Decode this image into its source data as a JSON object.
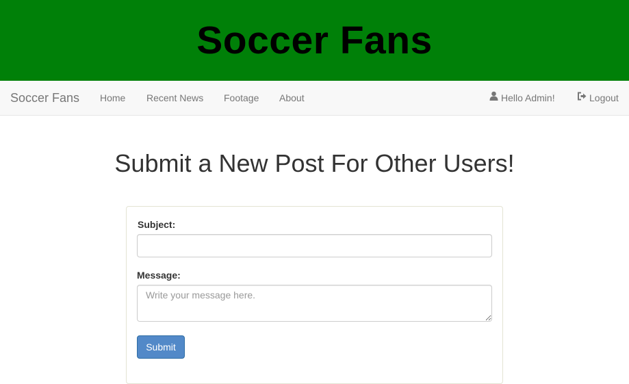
{
  "banner": {
    "title": "Soccer Fans"
  },
  "navbar": {
    "brand": "Soccer Fans",
    "links": [
      {
        "label": "Home"
      },
      {
        "label": "Recent News"
      },
      {
        "label": "Footage"
      },
      {
        "label": "About"
      }
    ],
    "user": {
      "greeting": "Hello Admin!",
      "icon": "user-icon"
    },
    "logout": {
      "label": "Logout",
      "icon": "logout-icon"
    }
  },
  "main": {
    "title": "Submit a New Post For Other Users!",
    "form": {
      "subject_label": "Subject:",
      "subject_value": "",
      "message_label": "Message:",
      "message_placeholder": "Write your message here.",
      "message_value": "",
      "submit_label": "Submit"
    }
  },
  "colors": {
    "banner": "#008008",
    "navbar": "#f8f8f8",
    "button": "#5289c8"
  }
}
